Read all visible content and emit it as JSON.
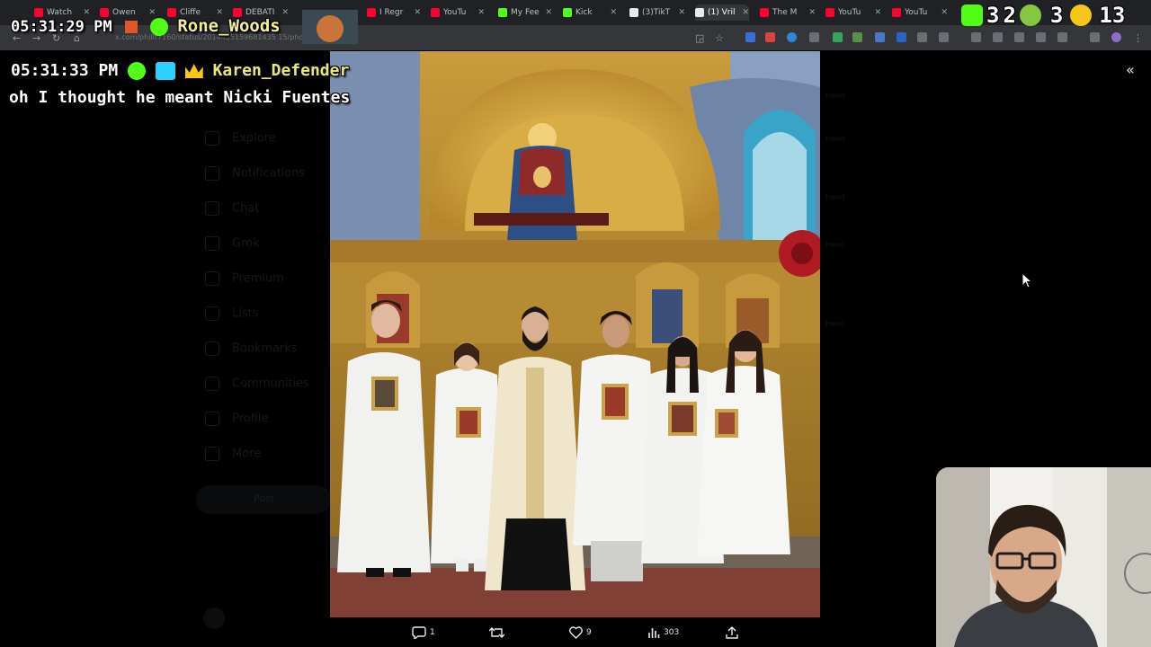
{
  "browser": {
    "tabs": [
      {
        "label": "Watch",
        "color": "#ff0033"
      },
      {
        "label": "Owen",
        "color": "#ff0033"
      },
      {
        "label": "Cliffe",
        "color": "#ff0033"
      },
      {
        "label": "DEBATI",
        "color": "#ff0033"
      },
      {
        "label": "I Regr",
        "color": "#ff0033"
      },
      {
        "label": "YouTu",
        "color": "#ff0033"
      },
      {
        "label": "My Fee",
        "color": "#53fc18"
      },
      {
        "label": "Kick",
        "color": "#53fc18"
      },
      {
        "label": "(3)TikT",
        "color": "#e7e9ea"
      },
      {
        "label": "(1) Vril",
        "color": "#e7e9ea"
      },
      {
        "label": "The M",
        "color": "#ff0033"
      },
      {
        "label": "YouTu",
        "color": "#ff0033"
      },
      {
        "label": "YouTu",
        "color": "#ff0033"
      }
    ],
    "url": "x.com/phillt7160/status/2014455159681435 15/photo/1"
  },
  "overlay_counters": {
    "kick_count": "3",
    "rumble_count": "2",
    "rumble_count_2": "3",
    "third_count": "1",
    "fourth_count": "3"
  },
  "clock_overlay": {
    "time": "05:31:29 PM",
    "username": "Rone_Woods"
  },
  "chat_message": {
    "time": "05:31:33 PM",
    "username": "Karen_Defender",
    "text": "oh I thought he meant Nicki Fuentes"
  },
  "sidebar_nav": [
    "Explore",
    "Notifications",
    "Chat",
    "Grok",
    "Premium",
    "Lists",
    "Bookmarks",
    "Communities",
    "Profile",
    "More"
  ],
  "post_button": "Post",
  "actions": {
    "replies": "1",
    "reposts": "",
    "likes": "9",
    "views": "303"
  },
  "colors": {
    "kick_green": "#53fc18",
    "youtube_red": "#ff0033",
    "crown_gold": "#f5c518"
  }
}
